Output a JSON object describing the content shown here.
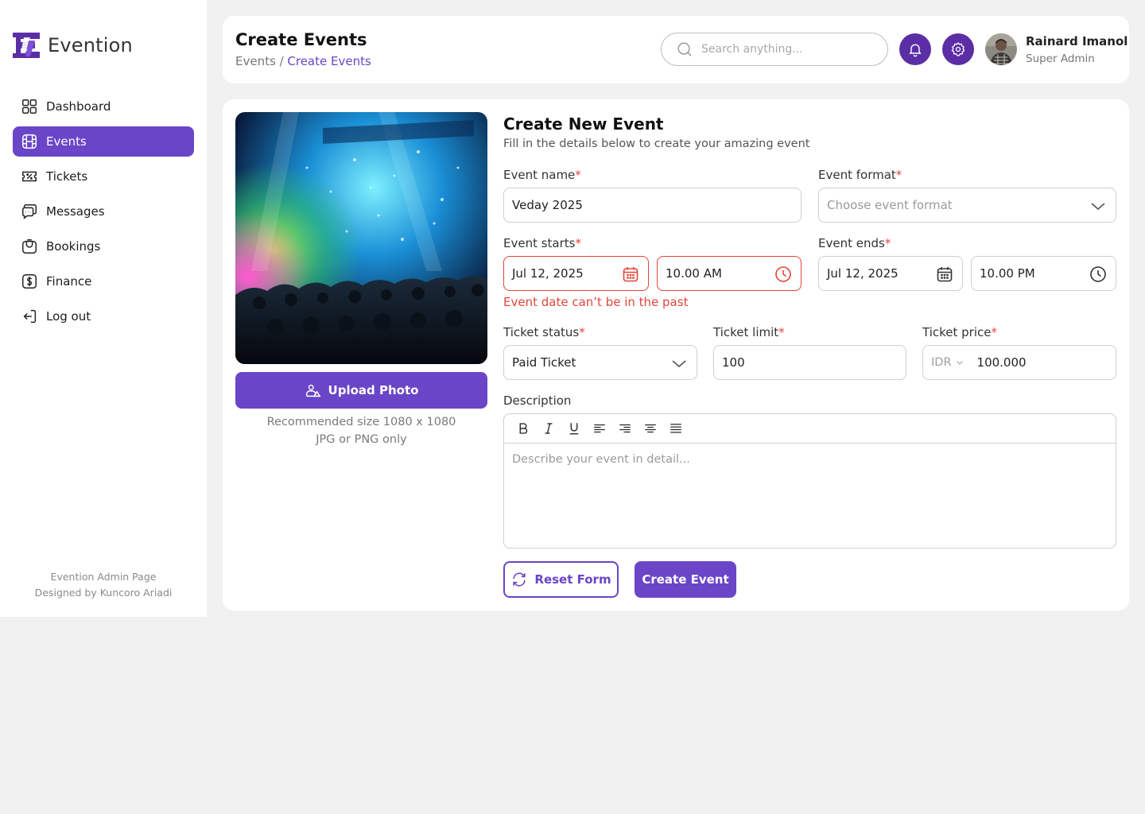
{
  "app": {
    "name": "Evention"
  },
  "sidebar": {
    "items": [
      {
        "label": "Dashboard",
        "icon": "grid-icon"
      },
      {
        "label": "Events",
        "icon": "film-icon",
        "active": true
      },
      {
        "label": "Tickets",
        "icon": "ticket-icon"
      },
      {
        "label": "Messages",
        "icon": "chat-icon"
      },
      {
        "label": "Bookings",
        "icon": "bag-icon"
      },
      {
        "label": "Finance",
        "icon": "dollar-icon"
      },
      {
        "label": "Log out",
        "icon": "logout-icon"
      }
    ],
    "footer_line1": "Evention Admin Page",
    "footer_line2": "Designed by Kuncoro Ariadi"
  },
  "header": {
    "title": "Create Events",
    "breadcrumb_root": "Events",
    "breadcrumb_sep": " / ",
    "breadcrumb_current": "Create Events",
    "search_placeholder": "Search anything...",
    "user_name": "Rainard Imanol",
    "user_role": "Super Admin"
  },
  "upload": {
    "button_label": "Upload Photo",
    "note_line1": "Recommended size 1080 x 1080",
    "note_line2": "JPG or PNG only"
  },
  "form": {
    "title": "Create New Event",
    "subtitle": "Fill in the details below to create your amazing event",
    "required_mark": "*",
    "event_name": {
      "label": "Event name",
      "value": "Veday 2025"
    },
    "event_format": {
      "label": "Event format",
      "placeholder": "Choose event format"
    },
    "event_starts": {
      "label": "Event starts",
      "date": "Jul 12, 2025",
      "time": "10.00 AM"
    },
    "event_ends": {
      "label": "Event ends",
      "date": "Jul 12, 2025",
      "time": "10.00 PM"
    },
    "error_message": "Event date can’t be in the past",
    "ticket_status": {
      "label": "Ticket status",
      "value": "Paid Ticket"
    },
    "ticket_limit": {
      "label": "Ticket limit",
      "value": "100"
    },
    "ticket_price": {
      "label": "Ticket price",
      "currency": "IDR",
      "value": "100.000"
    },
    "description": {
      "label": "Description",
      "placeholder": "Describe your event in detail..."
    },
    "reset_label": "Reset Form",
    "create_label": "Create Event"
  },
  "colors": {
    "accent": "#6a45c7",
    "accent_dark": "#5b2ea6",
    "error": "#e2453a"
  }
}
